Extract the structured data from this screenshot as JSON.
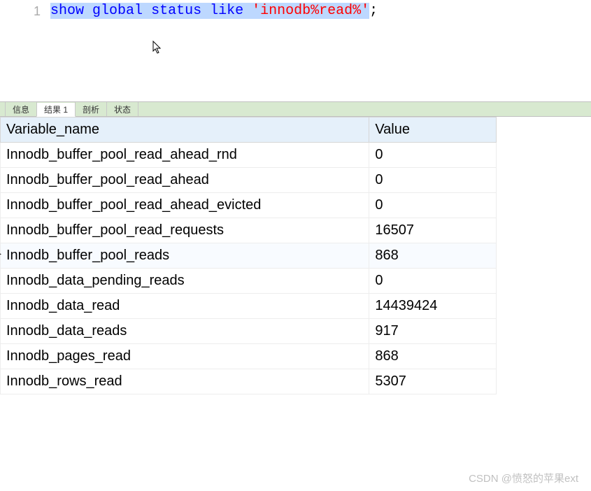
{
  "editor": {
    "line_number": "1",
    "sql_kw1": "show",
    "sql_kw2": "global",
    "sql_kw3": "status",
    "sql_kw4": "like",
    "sql_str": "'innodb%read%'",
    "sql_end": ";"
  },
  "tabs": {
    "info": "信息",
    "result1": "结果 1",
    "profile": "剖析",
    "status": "状态"
  },
  "table": {
    "header_variable": "Variable_name",
    "header_value": "Value",
    "rows": [
      {
        "name": "Innodb_buffer_pool_read_ahead_rnd",
        "value": "0"
      },
      {
        "name": "Innodb_buffer_pool_read_ahead",
        "value": "0"
      },
      {
        "name": "Innodb_buffer_pool_read_ahead_evicted",
        "value": "0"
      },
      {
        "name": "Innodb_buffer_pool_read_requests",
        "value": "16507"
      },
      {
        "name": "Innodb_buffer_pool_reads",
        "value": "868"
      },
      {
        "name": "Innodb_data_pending_reads",
        "value": "0"
      },
      {
        "name": "Innodb_data_read",
        "value": "14439424"
      },
      {
        "name": "Innodb_data_reads",
        "value": "917"
      },
      {
        "name": "Innodb_pages_read",
        "value": "868"
      },
      {
        "name": "Innodb_rows_read",
        "value": "5307"
      }
    ]
  },
  "watermark": "CSDN @愤怒的苹果ext"
}
